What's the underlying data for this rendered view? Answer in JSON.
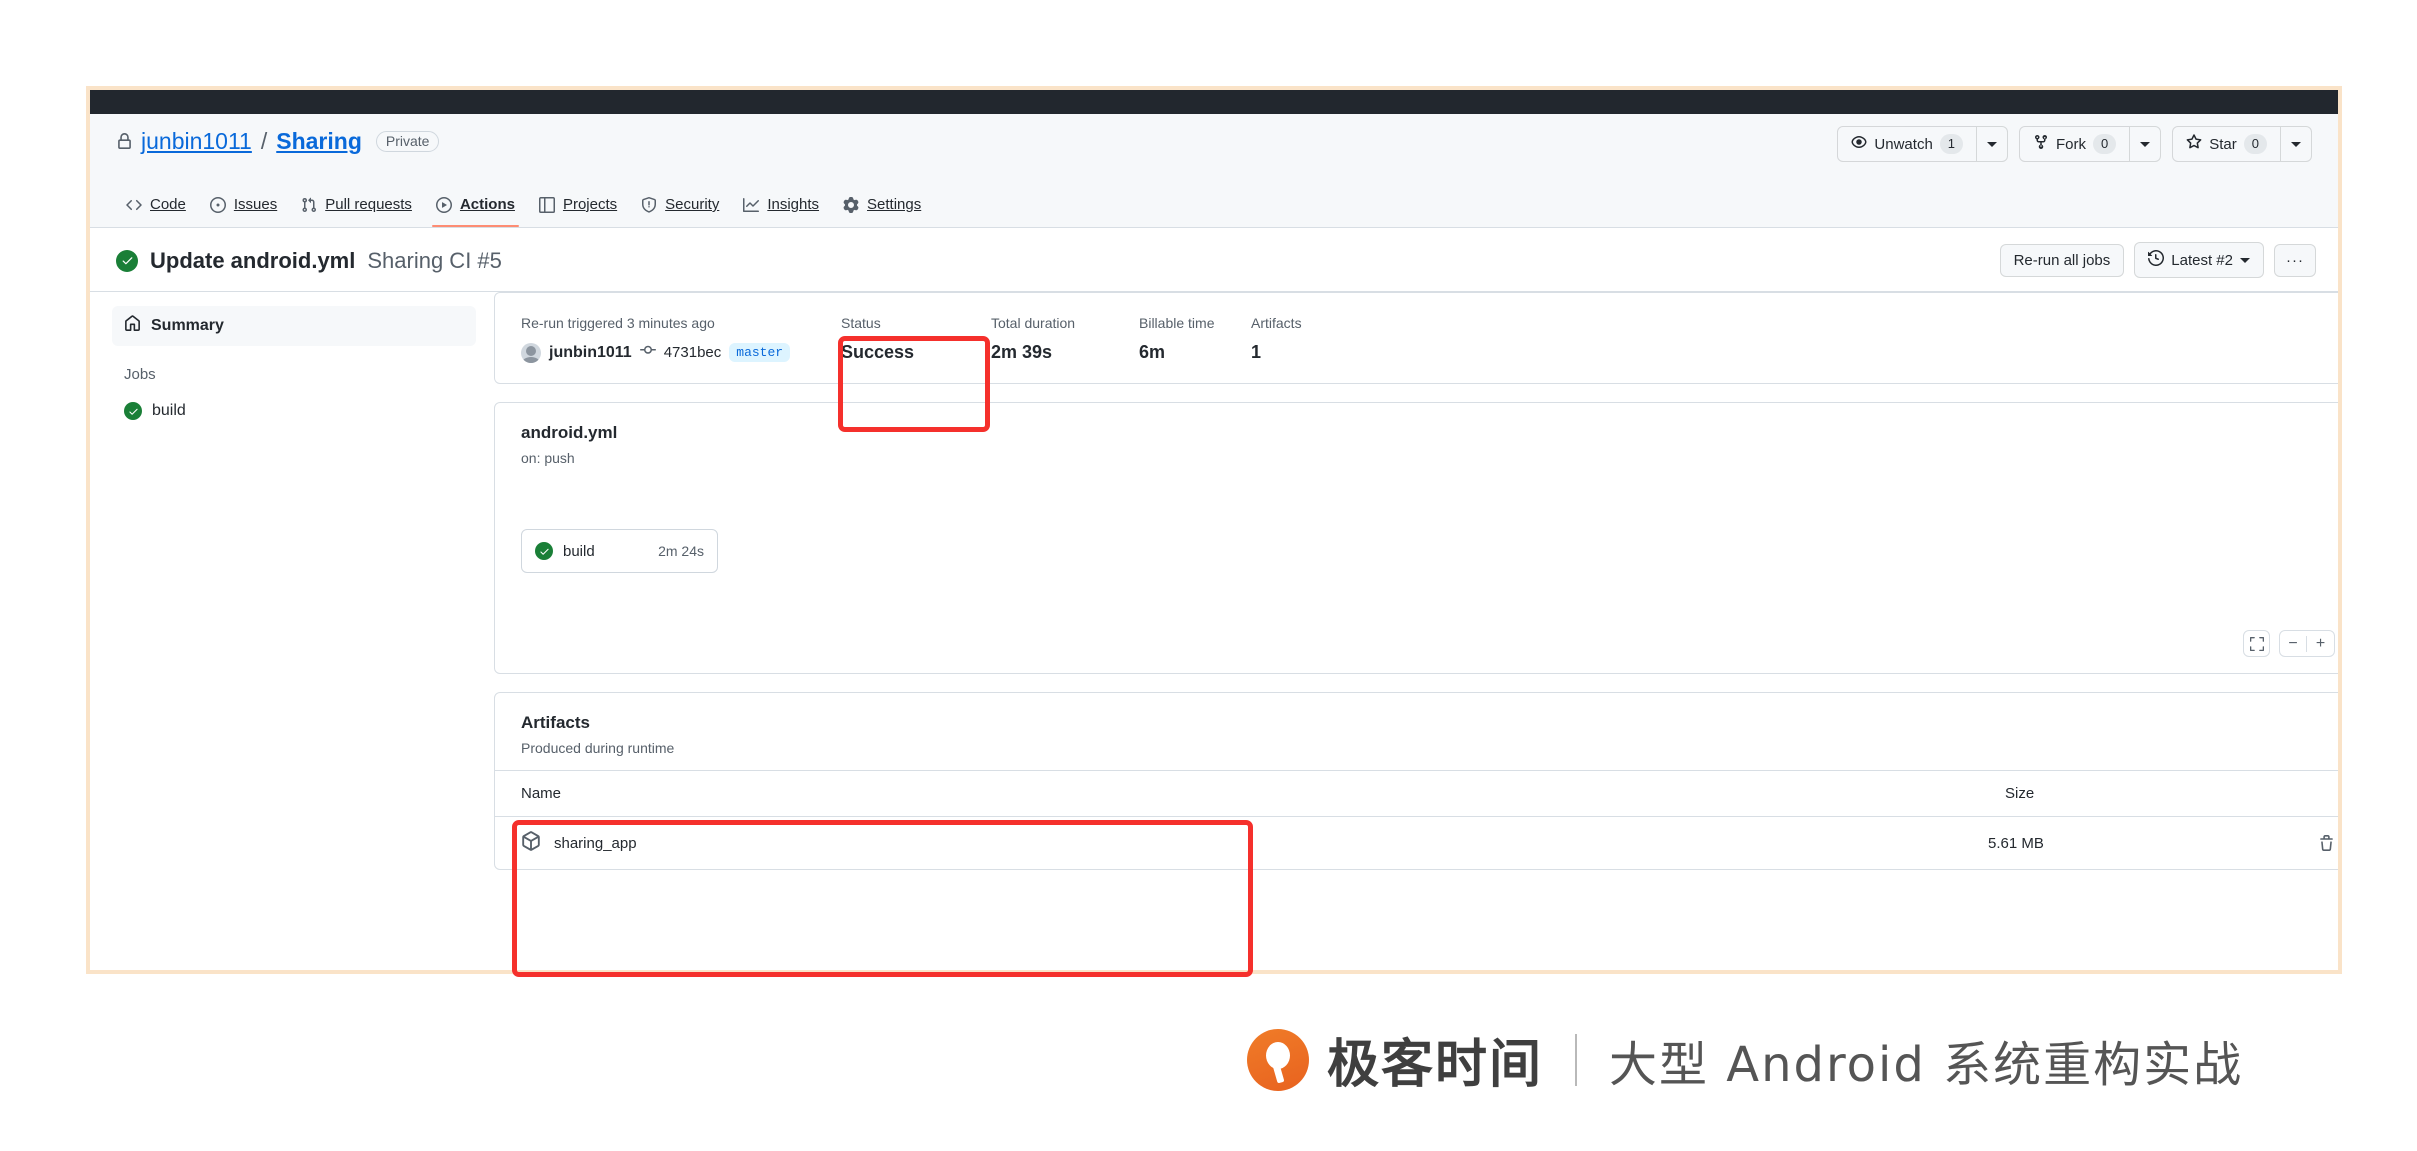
{
  "repo": {
    "owner": "junbin1011",
    "separator": "/",
    "name": "Sharing",
    "visibility": "Private",
    "lock_icon": "lock-icon"
  },
  "header_buttons": {
    "watch": {
      "label": "Unwatch",
      "count": "1",
      "icon": "eye-icon"
    },
    "fork": {
      "label": "Fork",
      "count": "0",
      "icon": "fork-icon"
    },
    "star": {
      "label": "Star",
      "count": "0",
      "icon": "star-icon"
    }
  },
  "nav": {
    "items": [
      {
        "label": "Code",
        "icon": "code-icon",
        "active": false
      },
      {
        "label": "Issues",
        "icon": "issue-opened-icon",
        "active": false
      },
      {
        "label": "Pull requests",
        "icon": "git-pull-request-icon",
        "active": false
      },
      {
        "label": "Actions",
        "icon": "play-icon",
        "active": true
      },
      {
        "label": "Projects",
        "icon": "table-icon",
        "active": false
      },
      {
        "label": "Security",
        "icon": "shield-icon",
        "active": false
      },
      {
        "label": "Insights",
        "icon": "graph-icon",
        "active": false
      },
      {
        "label": "Settings",
        "icon": "gear-icon",
        "active": false
      }
    ]
  },
  "run": {
    "status_icon": "check-circle-icon",
    "title": "Update android.yml",
    "subtitle": "Sharing CI #5",
    "rerun_button": "Re-run all jobs",
    "latest_button": "Latest #2",
    "latest_icon": "history-icon",
    "kebab": "···"
  },
  "sidebar": {
    "summary": {
      "label": "Summary",
      "icon": "home-icon"
    },
    "jobs_label": "Jobs",
    "jobs": [
      {
        "label": "build",
        "icon": "check-circle-icon"
      }
    ]
  },
  "summary_stats": {
    "trigger_text": "Re-run triggered 3 minutes ago",
    "actor": "junbin1011",
    "commit_sha": "4731bec",
    "commit_icon": "git-commit-icon",
    "branch": "master",
    "status_label": "Status",
    "status_value": "Success",
    "duration_label": "Total duration",
    "duration_value": "2m 39s",
    "billable_label": "Billable time",
    "billable_value": "6m",
    "artifacts_label": "Artifacts",
    "artifacts_value": "1"
  },
  "workflow_graph": {
    "file_name": "android.yml",
    "trigger": "on: push",
    "job": {
      "name": "build",
      "duration": "2m 24s",
      "icon": "check-circle-icon"
    },
    "controls": {
      "fit": "fit-screen-icon",
      "zoom_out": "−",
      "zoom_in": "+"
    }
  },
  "artifacts": {
    "title": "Artifacts",
    "subtitle": "Produced during runtime",
    "columns": {
      "name": "Name",
      "size": "Size"
    },
    "rows": [
      {
        "name": "sharing_app",
        "size": "5.61 MB",
        "icon": "package-icon",
        "delete_icon": "trash-icon"
      }
    ]
  },
  "annotations": {
    "color": "#f5302c",
    "boxes": [
      "status-highlight",
      "artifacts-highlight"
    ]
  },
  "watermark": {
    "brand_cn": "极客时间",
    "course": "大型 Android 系统重构实战",
    "logo_color": "#ec6c1f"
  }
}
